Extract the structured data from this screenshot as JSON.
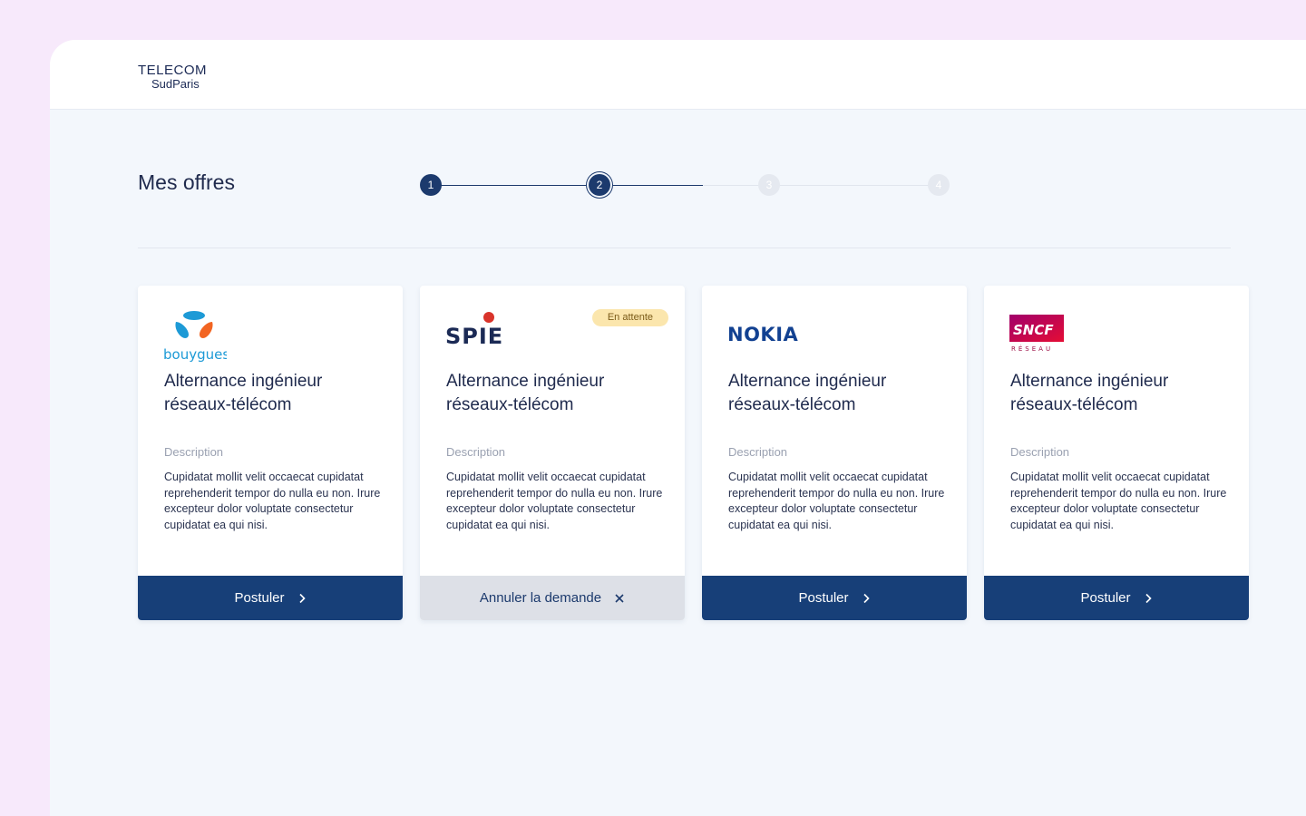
{
  "logo": {
    "line1": "TELECOM",
    "line2": "SudParis"
  },
  "page": {
    "title": "Mes offres"
  },
  "stepper": {
    "current": 2,
    "steps": [
      {
        "label": "1",
        "state": "done"
      },
      {
        "label": "2",
        "state": "current"
      },
      {
        "label": "3",
        "state": "pending"
      },
      {
        "label": "4",
        "state": "pending"
      }
    ]
  },
  "offers": [
    {
      "brand": "bouygues",
      "brand_text": "bouygues",
      "title": "Alternance ingénieur réseaux-télécom",
      "desc_label": "Description",
      "desc": "Cupidatat mollit velit occaecat cupidatat reprehenderit tempor do nulla eu non. Irure excepteur dolor voluptate consectetur cupidatat ea qui nisi.",
      "button": "Postuler",
      "badge": ""
    },
    {
      "brand": "spie",
      "brand_text": "SPIE",
      "title": "Alternance ingénieur réseaux-télécom",
      "desc_label": "Description",
      "desc": "Cupidatat mollit velit occaecat cupidatat reprehenderit tempor do nulla eu non. Irure excepteur dolor voluptate consectetur cupidatat ea qui nisi.",
      "button": "Annuler la demande",
      "badge": "En attente"
    },
    {
      "brand": "nokia",
      "brand_text": "NOKIA",
      "title": "Alternance ingénieur réseaux-télécom",
      "desc_label": "Description",
      "desc": "Cupidatat mollit velit occaecat cupidatat reprehenderit tempor do nulla eu non. Irure excepteur dolor voluptate consectetur cupidatat ea qui nisi.",
      "button": "Postuler",
      "badge": ""
    },
    {
      "brand": "sncf",
      "brand_text": "SNCF",
      "brand_sub": "RÉSEAU",
      "title": "Alternance ingénieur réseaux-télécom",
      "desc_label": "Description",
      "desc": "Cupidatat mollit velit occaecat cupidatat reprehenderit tempor do nulla eu non. Irure excepteur dolor voluptate consectetur cupidatat ea qui nisi.",
      "button": "Postuler",
      "badge": ""
    }
  ],
  "colors": {
    "primary": "#173f78",
    "page_bg": "#f3f7fc",
    "outer_bg": "#f7e9fb",
    "badge_bg": "#fbe6ad",
    "secondary_btn": "#dde0e7"
  }
}
